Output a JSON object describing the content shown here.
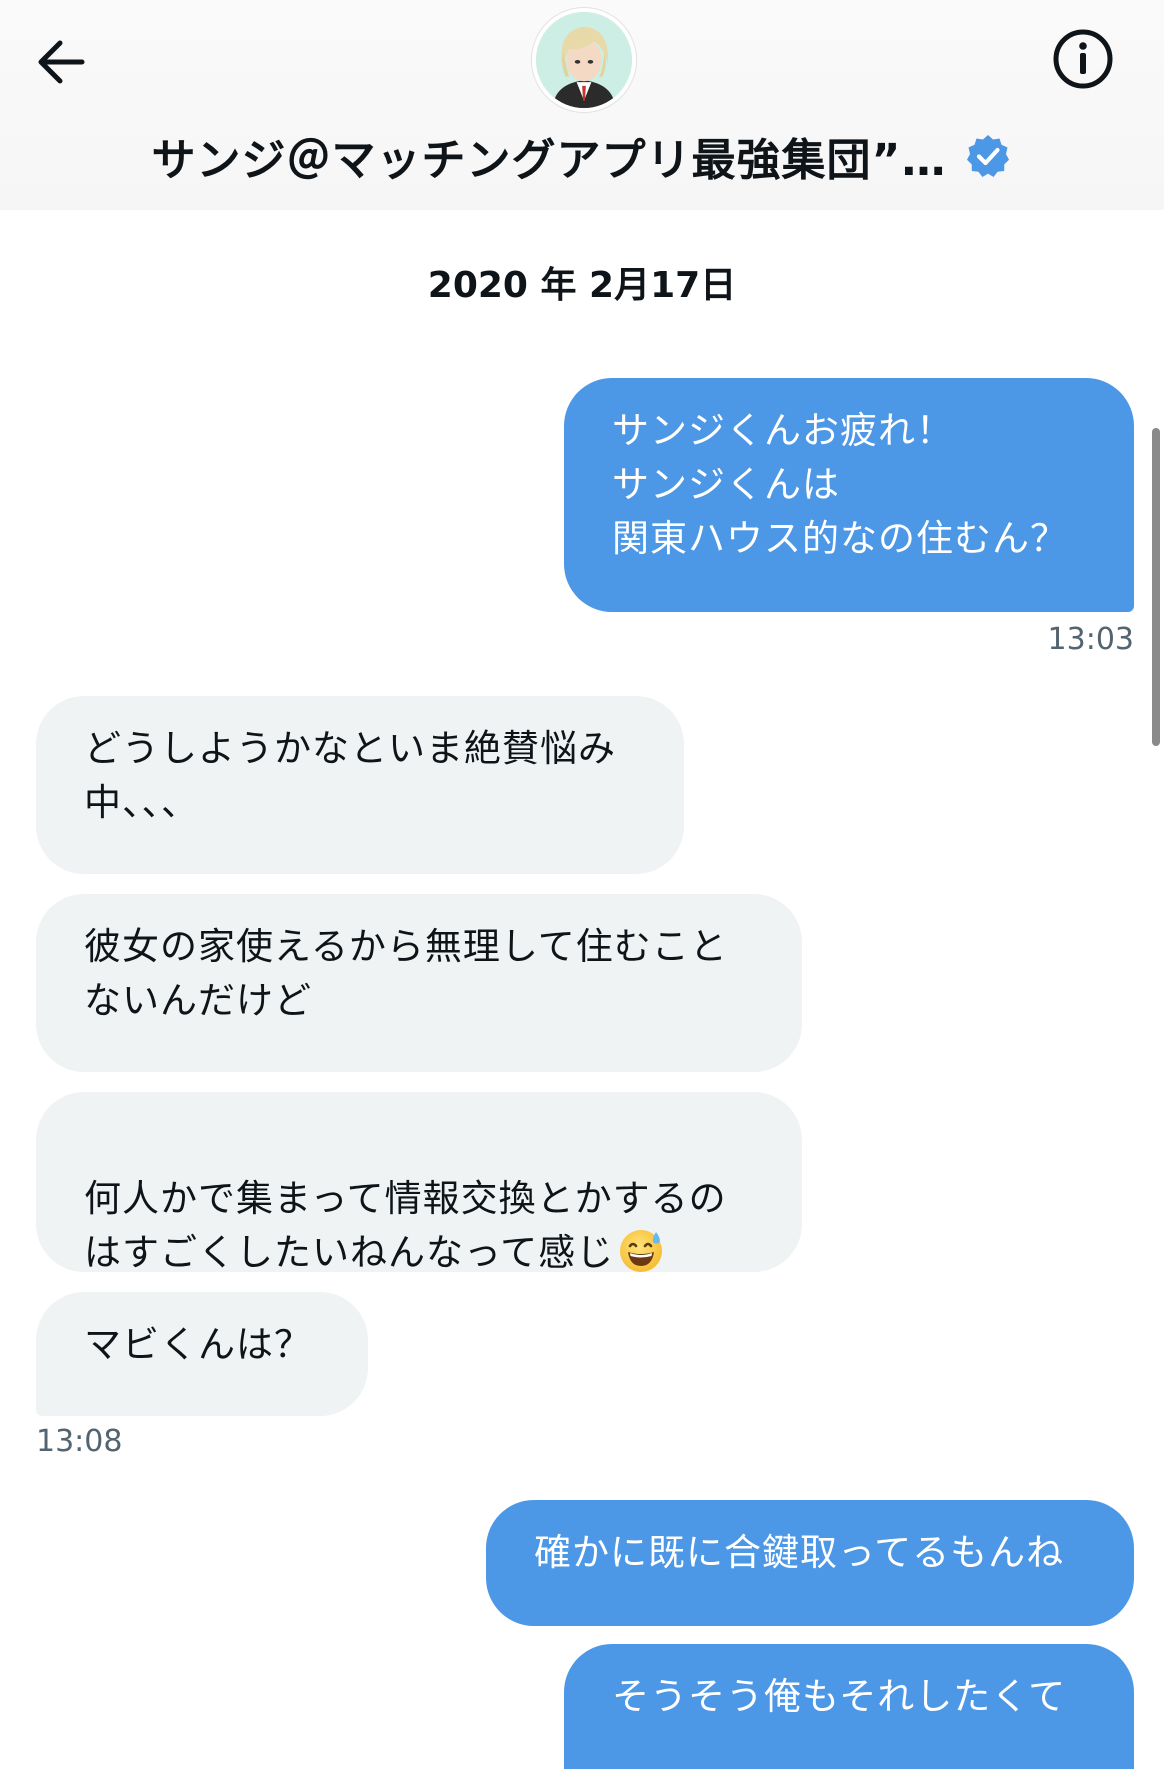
{
  "header": {
    "account_name": "サンジ＠マッチングアプリ最強集団”…",
    "back_icon": "arrow-left-icon",
    "info_icon": "info-circle-icon",
    "verified_icon": "verified-badge-icon",
    "accent_color": "#4c97e6"
  },
  "conversation": {
    "date": "2020 年 2月17日",
    "messages": [
      {
        "direction": "outgoing",
        "text": "サンジくんお疲れ！\nサンジくんは\n関東ハウス的なの住むん？"
      },
      {
        "direction": "outgoing_time",
        "text": "13:03"
      },
      {
        "direction": "incoming",
        "text": "どうしようかなといま絶賛悩み\n中、、、"
      },
      {
        "direction": "incoming",
        "text": "彼女の家使えるから無理して住むこと\nないんだけど"
      },
      {
        "direction": "incoming",
        "text": "何人かで集まって情報交換とかするの\nはすごくしたいねんなって感じ",
        "emoji": "grinning-face-with-sweat-icon"
      },
      {
        "direction": "incoming",
        "text": "マビくんは？"
      },
      {
        "direction": "incoming_time",
        "text": "13:08"
      },
      {
        "direction": "outgoing",
        "text": "確かに既に合鍵取ってるもんね"
      },
      {
        "direction": "outgoing",
        "text": "そうそう俺もそれしたくて"
      }
    ]
  }
}
